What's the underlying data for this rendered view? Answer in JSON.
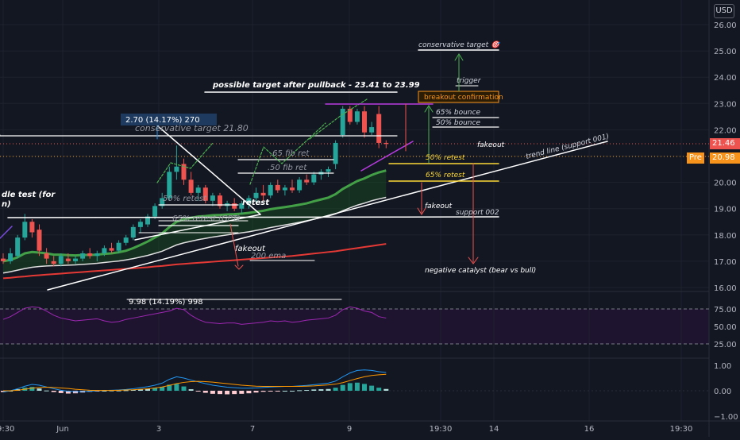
{
  "header": {
    "currency_label": "USD"
  },
  "price_axis": {
    "ticks": [
      "26.00",
      "25.00",
      "24.00",
      "23.00",
      "22.00",
      "21.00",
      "20.00",
      "19.00",
      "18.00",
      "17.00",
      "16.00"
    ],
    "last_price": "21.46",
    "pre_label": "Pre",
    "pre_price": "20.98",
    "colors": {
      "last": "#ef5350",
      "pre": "#f7931a"
    }
  },
  "rsi_axis": {
    "ticks": [
      "75.00",
      "50.00",
      "25.00"
    ]
  },
  "macd_axis": {
    "ticks": [
      "1.00",
      "0.00",
      "−1.00"
    ]
  },
  "time_axis": {
    "ticks": [
      "19:30",
      "Jun",
      "3",
      "7",
      "9",
      "19:30",
      "14",
      "16",
      "19:30"
    ]
  },
  "annotations": {
    "possible_target": "possible target after pullback - 23.41 to 23.99",
    "conservative_target_top": "conservative target 🎯",
    "trigger": "trigger",
    "breakout_confirmation": "breakout confirmation",
    "bounce_65": "65% bounce",
    "bounce_50": "50% bounce",
    "fakeout_right": "fakeout",
    "trend_line": "trend line (support 001)",
    "retest_50_right": "50% retest",
    "retest_65_right": "65% retest",
    "fakeout_mid": "fakeout",
    "support_002": "support 002",
    "negative_catalyst": "negative catalyst (bear vs bull)",
    "measure_label": "2.70 (14.17%) 270",
    "conservative_target_left": "conservative target 21.80",
    "fib_65": ".65 fib ret",
    "fib_50": ".50 fib ret",
    "retest_50_left": "50% retest",
    "retest_word": "retest",
    "retest_65_left": "65% retest (GPT)",
    "fakeout_left": "fakeout",
    "ema_200": "200 ema",
    "candle_test_1": "dle test (for",
    "candle_test_2": "n)",
    "rsi_measure": "9.98 (14.19%) 998"
  },
  "chart_data": {
    "type": "candlestick",
    "instrument_currency": "USD",
    "price_range": [
      15.8,
      26.5
    ],
    "rsi_range": [
      13,
      95
    ],
    "macd_range": [
      -1.3,
      1.2
    ],
    "grid": true,
    "candles": [
      {
        "o": 17.1,
        "h": 17.3,
        "l": 16.9,
        "c": 17.0
      },
      {
        "o": 17.0,
        "h": 17.5,
        "l": 16.9,
        "c": 17.3
      },
      {
        "o": 17.2,
        "h": 18.0,
        "l": 17.1,
        "c": 17.9
      },
      {
        "o": 17.9,
        "h": 18.8,
        "l": 17.8,
        "c": 18.5
      },
      {
        "o": 18.5,
        "h": 18.6,
        "l": 17.9,
        "c": 18.1
      },
      {
        "o": 18.2,
        "h": 18.4,
        "l": 17.2,
        "c": 17.4
      },
      {
        "o": 17.3,
        "h": 17.5,
        "l": 16.9,
        "c": 17.1
      },
      {
        "o": 17.0,
        "h": 17.2,
        "l": 16.8,
        "c": 16.9
      },
      {
        "o": 16.9,
        "h": 17.3,
        "l": 16.8,
        "c": 17.2
      },
      {
        "o": 17.1,
        "h": 17.3,
        "l": 16.9,
        "c": 17.0
      },
      {
        "o": 17.0,
        "h": 17.2,
        "l": 16.9,
        "c": 17.1
      },
      {
        "o": 17.1,
        "h": 17.4,
        "l": 17.0,
        "c": 17.3
      },
      {
        "o": 17.3,
        "h": 17.5,
        "l": 17.1,
        "c": 17.2
      },
      {
        "o": 17.2,
        "h": 17.4,
        "l": 17.0,
        "c": 17.3
      },
      {
        "o": 17.3,
        "h": 17.6,
        "l": 17.2,
        "c": 17.5
      },
      {
        "o": 17.5,
        "h": 17.7,
        "l": 17.3,
        "c": 17.4
      },
      {
        "o": 17.4,
        "h": 17.8,
        "l": 17.3,
        "c": 17.7
      },
      {
        "o": 17.7,
        "h": 18.0,
        "l": 17.6,
        "c": 17.9
      },
      {
        "o": 17.9,
        "h": 18.4,
        "l": 17.8,
        "c": 18.3
      },
      {
        "o": 18.3,
        "h": 18.6,
        "l": 18.1,
        "c": 18.5
      },
      {
        "o": 18.4,
        "h": 18.8,
        "l": 18.3,
        "c": 18.7
      },
      {
        "o": 18.7,
        "h": 19.2,
        "l": 18.6,
        "c": 19.1
      },
      {
        "o": 19.1,
        "h": 19.6,
        "l": 19.0,
        "c": 19.4
      },
      {
        "o": 19.4,
        "h": 20.6,
        "l": 19.3,
        "c": 20.4
      },
      {
        "o": 20.4,
        "h": 21.4,
        "l": 20.1,
        "c": 20.6
      },
      {
        "o": 20.7,
        "h": 20.9,
        "l": 19.9,
        "c": 20.1
      },
      {
        "o": 20.1,
        "h": 20.4,
        "l": 19.5,
        "c": 19.6
      },
      {
        "o": 19.6,
        "h": 19.9,
        "l": 19.3,
        "c": 19.8
      },
      {
        "o": 19.8,
        "h": 19.9,
        "l": 19.2,
        "c": 19.3
      },
      {
        "o": 19.3,
        "h": 19.6,
        "l": 19.1,
        "c": 19.5
      },
      {
        "o": 19.5,
        "h": 19.6,
        "l": 19.0,
        "c": 19.1
      },
      {
        "o": 19.1,
        "h": 19.3,
        "l": 18.9,
        "c": 19.2
      },
      {
        "o": 19.2,
        "h": 19.4,
        "l": 18.9,
        "c": 19.0
      },
      {
        "o": 19.0,
        "h": 19.3,
        "l": 18.8,
        "c": 19.2
      },
      {
        "o": 19.2,
        "h": 19.5,
        "l": 19.0,
        "c": 19.4
      },
      {
        "o": 19.4,
        "h": 19.8,
        "l": 19.2,
        "c": 19.6
      },
      {
        "o": 19.6,
        "h": 19.9,
        "l": 19.3,
        "c": 19.5
      },
      {
        "o": 19.5,
        "h": 20.0,
        "l": 19.4,
        "c": 19.9
      },
      {
        "o": 19.9,
        "h": 20.1,
        "l": 19.6,
        "c": 19.7
      },
      {
        "o": 19.7,
        "h": 19.9,
        "l": 19.5,
        "c": 19.8
      },
      {
        "o": 19.8,
        "h": 20.1,
        "l": 19.6,
        "c": 19.7
      },
      {
        "o": 19.7,
        "h": 20.2,
        "l": 19.6,
        "c": 20.1
      },
      {
        "o": 20.1,
        "h": 20.3,
        "l": 19.9,
        "c": 20.0
      },
      {
        "o": 20.0,
        "h": 20.4,
        "l": 19.9,
        "c": 20.3
      },
      {
        "o": 20.3,
        "h": 20.5,
        "l": 20.1,
        "c": 20.4
      },
      {
        "o": 20.4,
        "h": 20.6,
        "l": 20.2,
        "c": 20.5
      },
      {
        "o": 20.7,
        "h": 21.6,
        "l": 20.5,
        "c": 21.5
      },
      {
        "o": 21.8,
        "h": 22.9,
        "l": 21.7,
        "c": 22.8
      },
      {
        "o": 22.8,
        "h": 22.9,
        "l": 22.2,
        "c": 22.3
      },
      {
        "o": 22.3,
        "h": 22.8,
        "l": 22.2,
        "c": 22.7
      },
      {
        "o": 22.7,
        "h": 22.9,
        "l": 21.7,
        "c": 21.9
      },
      {
        "o": 21.9,
        "h": 22.3,
        "l": 21.8,
        "c": 22.1
      },
      {
        "o": 22.6,
        "h": 22.9,
        "l": 21.3,
        "c": 21.5
      },
      {
        "o": 21.5,
        "h": 21.6,
        "l": 21.3,
        "c": 21.46
      }
    ],
    "ema_fast": [
      17.0,
      17.05,
      17.15,
      17.3,
      17.35,
      17.33,
      17.3,
      17.25,
      17.25,
      17.23,
      17.22,
      17.24,
      17.24,
      17.25,
      17.28,
      17.3,
      17.34,
      17.4,
      17.5,
      17.62,
      17.75,
      17.9,
      18.06,
      18.3,
      18.5,
      18.6,
      18.65,
      18.7,
      18.72,
      18.75,
      18.76,
      18.78,
      18.79,
      18.81,
      18.84,
      18.88,
      18.92,
      18.98,
      19.02,
      19.06,
      19.1,
      19.15,
      19.2,
      19.28,
      19.35,
      19.42,
      19.55,
      19.75,
      19.9,
      20.05,
      20.15,
      20.28,
      20.38,
      20.45
    ],
    "ema_mid": [
      16.55,
      16.6,
      16.66,
      16.72,
      16.77,
      16.8,
      16.82,
      16.83,
      16.84,
      16.85,
      16.86,
      16.88,
      16.9,
      16.92,
      16.95,
      16.98,
      17.01,
      17.05,
      17.1,
      17.16,
      17.22,
      17.3,
      17.38,
      17.5,
      17.62,
      17.7,
      17.76,
      17.82,
      17.87,
      17.92,
      17.96,
      18.0,
      18.04,
      18.08,
      18.12,
      18.17,
      18.22,
      18.28,
      18.33,
      18.38,
      18.43,
      18.48,
      18.54,
      18.6,
      18.66,
      18.72,
      18.8,
      18.92,
      19.03,
      19.13,
      19.21,
      19.3,
      19.37,
      19.43
    ],
    "ema_200": [
      16.35,
      16.37,
      16.4,
      16.42,
      16.45,
      16.47,
      16.49,
      16.51,
      16.53,
      16.55,
      16.57,
      16.59,
      16.61,
      16.63,
      16.65,
      16.67,
      16.69,
      16.71,
      16.73,
      16.75,
      16.77,
      16.8,
      16.82,
      16.85,
      16.88,
      16.9,
      16.92,
      16.94,
      16.96,
      16.98,
      17.0,
      17.02,
      17.04,
      17.06,
      17.08,
      17.1,
      17.12,
      17.14,
      17.16,
      17.18,
      17.2,
      17.23,
      17.26,
      17.29,
      17.32,
      17.35,
      17.38,
      17.42,
      17.46,
      17.5,
      17.54,
      17.58,
      17.62,
      17.66
    ],
    "price_lines": [
      {
        "label": "conservative target",
        "value": 25.0
      },
      {
        "label": "trigger",
        "value": 23.65
      },
      {
        "label": "breakout confirmation",
        "value": 23.0
      },
      {
        "label": "65% bounce",
        "value": 22.45
      },
      {
        "label": "50% bounce",
        "value": 22.1
      },
      {
        "label": "50% retest",
        "value": 20.7
      },
      {
        "label": "65% retest",
        "value": 20.05
      },
      {
        "label": "support 002",
        "value": 18.65
      },
      {
        "label": "conservative target",
        "value": 21.8
      },
      {
        "label": "200 ema",
        "value": 17.0
      }
    ],
    "rsi": [
      60,
      64,
      70,
      76,
      78,
      77,
      72,
      66,
      62,
      60,
      58,
      59,
      60,
      61,
      58,
      56,
      57,
      60,
      62,
      64,
      66,
      68,
      70,
      72,
      76,
      74,
      66,
      60,
      56,
      55,
      54,
      55,
      55,
      53,
      54,
      55,
      56,
      58,
      57,
      58,
      56,
      57,
      59,
      60,
      61,
      62,
      66,
      74,
      78,
      76,
      72,
      70,
      64,
      62
    ],
    "macd_line": [
      -0.05,
      0.0,
      0.08,
      0.18,
      0.25,
      0.22,
      0.15,
      0.08,
      0.02,
      -0.02,
      -0.04,
      -0.03,
      -0.02,
      0.0,
      0.01,
      0.02,
      0.03,
      0.05,
      0.08,
      0.12,
      0.16,
      0.22,
      0.3,
      0.45,
      0.55,
      0.5,
      0.42,
      0.35,
      0.28,
      0.22,
      0.18,
      0.14,
      0.12,
      0.1,
      0.1,
      0.11,
      0.13,
      0.15,
      0.16,
      0.17,
      0.17,
      0.19,
      0.21,
      0.24,
      0.27,
      0.3,
      0.38,
      0.55,
      0.7,
      0.8,
      0.82,
      0.8,
      0.75,
      0.72
    ],
    "signal_line": [
      0.0,
      0.0,
      0.02,
      0.06,
      0.1,
      0.13,
      0.14,
      0.13,
      0.11,
      0.09,
      0.06,
      0.04,
      0.02,
      0.01,
      0.01,
      0.01,
      0.02,
      0.03,
      0.04,
      0.06,
      0.08,
      0.11,
      0.15,
      0.21,
      0.28,
      0.33,
      0.36,
      0.37,
      0.36,
      0.34,
      0.31,
      0.28,
      0.25,
      0.22,
      0.2,
      0.18,
      0.17,
      0.17,
      0.17,
      0.17,
      0.17,
      0.17,
      0.18,
      0.19,
      0.21,
      0.23,
      0.26,
      0.32,
      0.4,
      0.48,
      0.55,
      0.6,
      0.63,
      0.65
    ]
  }
}
